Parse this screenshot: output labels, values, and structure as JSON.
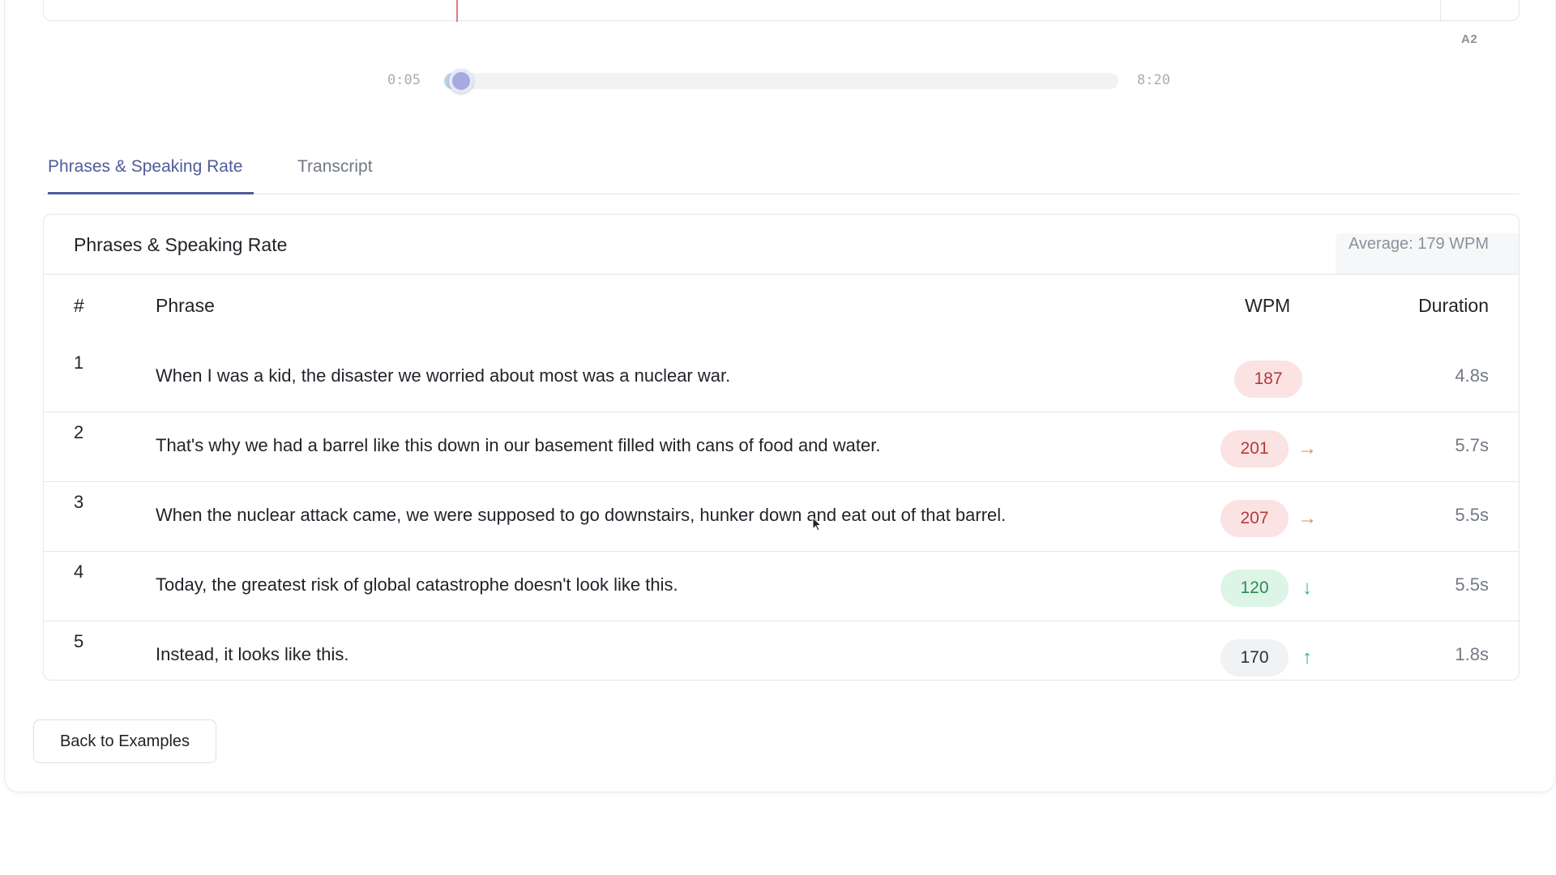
{
  "waveform": {
    "track_tag": "A2"
  },
  "timeline": {
    "start": "0:05",
    "end": "8:20",
    "progress": 0.025
  },
  "tabs": [
    {
      "label": "Phrases & Speaking Rate",
      "active": true
    },
    {
      "label": "Transcript",
      "active": false
    }
  ],
  "table": {
    "title": "Phrases & Speaking Rate",
    "average": "Average: 179 WPM",
    "columns": {
      "num": "#",
      "phrase": "Phrase",
      "wpm": "WPM",
      "duration": "Duration"
    },
    "rows": [
      {
        "num": "1",
        "phrase": "When I was a kid, the disaster we worried about most was a nuclear war.",
        "wpm": "187",
        "level": "high",
        "trend": "",
        "trend_icon": "",
        "duration": "4.8s"
      },
      {
        "num": "2",
        "phrase": "That's why we had a barrel like this down in our basement filled with cans of food and water.",
        "wpm": "201",
        "level": "high",
        "trend": "→",
        "trend_icon": "arrow-right-icon",
        "duration": "5.7s"
      },
      {
        "num": "3",
        "phrase": "When the nuclear attack came, we were supposed to go downstairs, hunker down and eat out of that barrel.",
        "wpm": "207",
        "level": "high",
        "trend": "→",
        "trend_icon": "arrow-right-icon",
        "duration": "5.5s"
      },
      {
        "num": "4",
        "phrase": "Today, the greatest risk of global catastrophe doesn't look like this.",
        "wpm": "120",
        "level": "low",
        "trend": "↓",
        "trend_icon": "arrow-down-icon",
        "duration": "5.5s"
      },
      {
        "num": "5",
        "phrase": "Instead, it looks like this.",
        "wpm": "170",
        "level": "normal",
        "trend": "↑",
        "trend_icon": "arrow-up-icon",
        "duration": "1.8s"
      }
    ]
  },
  "footer": {
    "back_label": "Back to Examples"
  },
  "colors": {
    "accent": "#4f5b9a",
    "high_bg": "#fbe3e3",
    "high_text": "#b23a3a",
    "low_bg": "#dcf5e6",
    "low_text": "#2e8a52",
    "trend_orange": "#e58a5a",
    "trend_green": "#36b56a"
  }
}
